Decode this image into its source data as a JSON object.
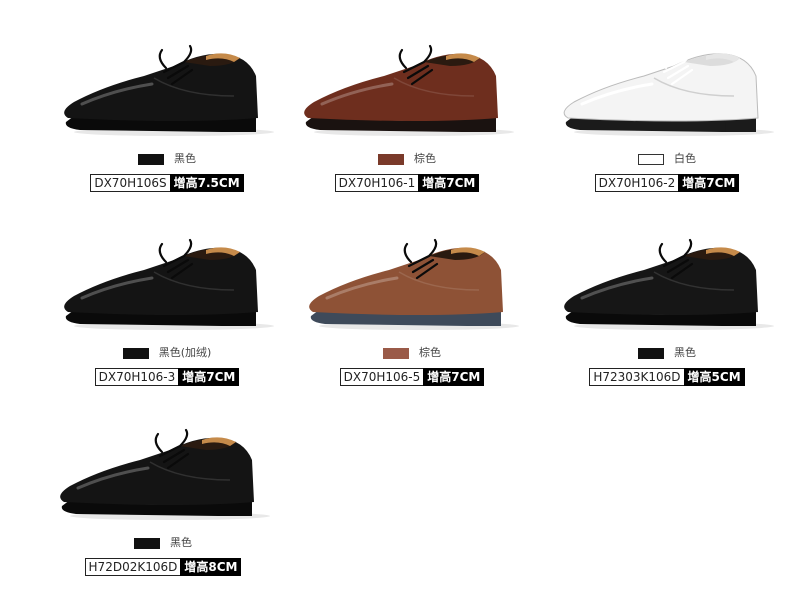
{
  "products": [
    {
      "color_name": "黑色",
      "swatch": "#111111",
      "code": "DX70H106S",
      "height": "增高7.5CM",
      "upper": "#141414",
      "sole": "#0a0a0a"
    },
    {
      "color_name": "棕色",
      "swatch": "#7a3a2a",
      "code": "DX70H106-1",
      "height": "增高7CM",
      "upper": "#6e2e1e",
      "sole": "#1a1210"
    },
    {
      "color_name": "白色",
      "swatch": "#ffffff",
      "code": "DX70H106-2",
      "height": "增高7CM",
      "upper": "#f4f4f4",
      "sole": "#1b1b1b"
    },
    {
      "color_name": "黑色(加绒)",
      "swatch": "#111111",
      "code": "DX70H106-3",
      "height": "增高7CM",
      "upper": "#141414",
      "sole": "#0a0a0a"
    },
    {
      "color_name": "棕色",
      "swatch": "#9a5a48",
      "code": "DX70H106-5",
      "height": "增高7CM",
      "upper": "#8e5236",
      "sole": "#3e4a5a"
    },
    {
      "color_name": "黑色",
      "swatch": "#111111",
      "code": "H72303K106D",
      "height": "增高5CM",
      "upper": "#161616",
      "sole": "#0a0a0a"
    },
    {
      "color_name": "黑色",
      "swatch": "#111111",
      "code": "H72D02K106D",
      "height": "增高8CM",
      "upper": "#141414",
      "sole": "#0a0a0a"
    }
  ]
}
